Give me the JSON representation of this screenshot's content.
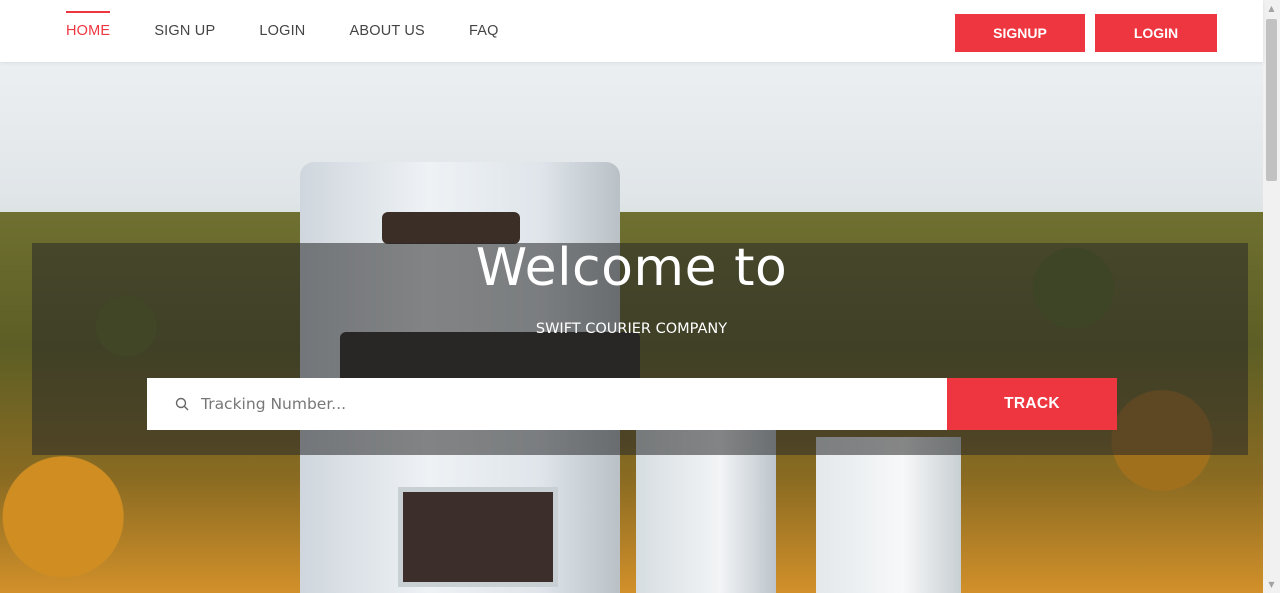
{
  "nav": {
    "items": [
      {
        "label": "HOME",
        "active": true
      },
      {
        "label": "SIGN UP",
        "active": false
      },
      {
        "label": "LOGIN",
        "active": false
      },
      {
        "label": "ABOUT US",
        "active": false
      },
      {
        "label": "FAQ",
        "active": false
      }
    ],
    "signup_button": "SIGNUP",
    "login_button": "LOGIN"
  },
  "hero": {
    "title": "Welcome to",
    "subtitle": "SWIFT COURIER COMPANY",
    "search": {
      "placeholder": "Tracking Number...",
      "value": "",
      "icon": "search-icon"
    },
    "track_button": "TRACK"
  },
  "colors": {
    "accent": "#ee3640",
    "nav_text": "#444444"
  }
}
